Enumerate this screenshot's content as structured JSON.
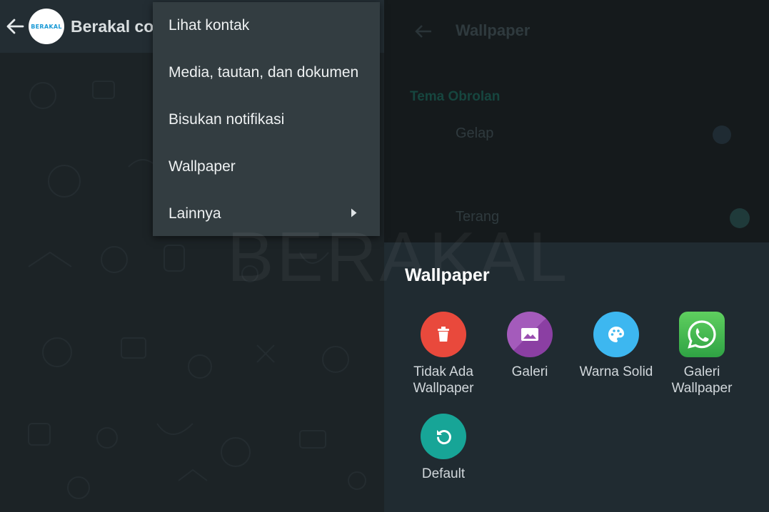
{
  "chat": {
    "avatar_text": "BERAKAL",
    "contact_name": "Berakal co"
  },
  "menu": {
    "items": [
      {
        "label": "Lihat kontak"
      },
      {
        "label": "Media, tautan, dan dokumen"
      },
      {
        "label": "Bisukan notifikasi"
      },
      {
        "label": "Wallpaper"
      },
      {
        "label": "Lainnya"
      }
    ]
  },
  "settings_behind": {
    "title": "Wallpaper",
    "section": "Tema Obrolan",
    "item1": "Gelap",
    "item2": "Terang"
  },
  "sheet": {
    "title": "Wallpaper",
    "options": [
      {
        "label": "Tidak Ada Wallpaper",
        "icon": "trash-icon",
        "color": "#e9493c"
      },
      {
        "label": "Galeri",
        "icon": "image-icon",
        "color": "#9a4fb0"
      },
      {
        "label": "Warna Solid",
        "icon": "palette-icon",
        "color": "#3db7f0"
      },
      {
        "label": "Galeri Wallpaper",
        "icon": "whatsapp-icon",
        "color": "#3fb14e"
      },
      {
        "label": "Default",
        "icon": "reset-icon",
        "color": "#17a597"
      }
    ]
  },
  "watermark": "BERAKAL"
}
